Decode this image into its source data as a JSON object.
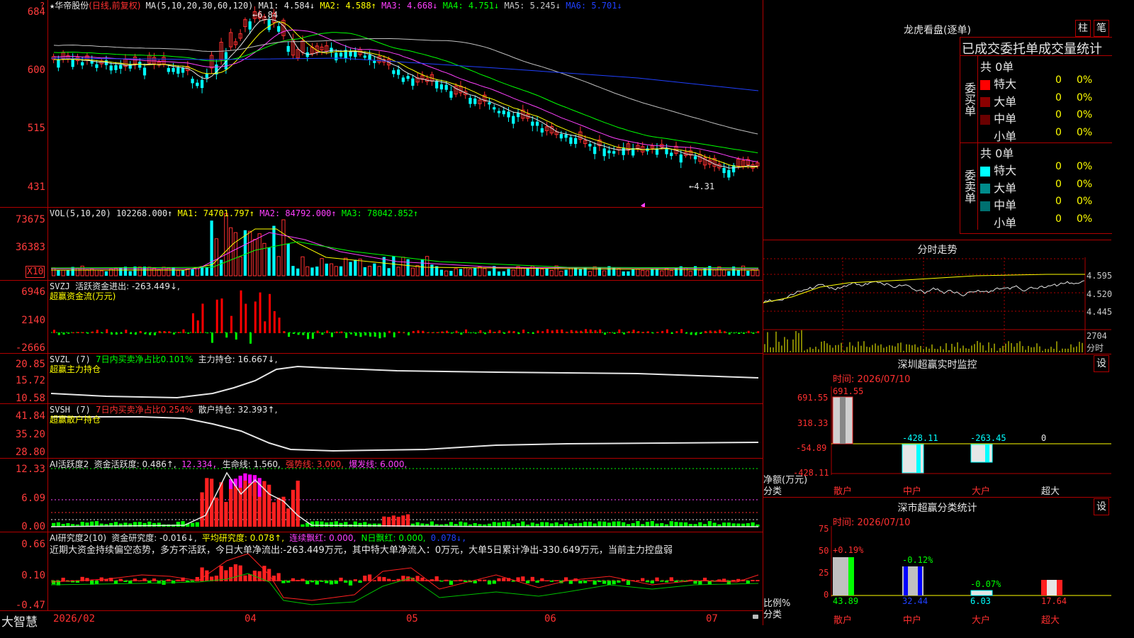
{
  "stock": {
    "name": "华帝股份",
    "period": "(日线,前复权)",
    "star": "★"
  },
  "main": {
    "yticks": [
      "684",
      "600",
      "515",
      "431"
    ],
    "ma_title": "MA(5,10,20,30,60,120)",
    "ma1": "MA1: 4.584↓",
    "ma2": "MA2: 4.588↑",
    "ma3": "MA3: 4.668↓",
    "ma4": "MA4: 4.751↓",
    "ma5": "MA5: 5.245↓",
    "ma6": "MA6: 5.701↓",
    "high_label": "6.84",
    "low_label": "4.31",
    "colors": {
      "ma1": "#e6e6e6",
      "ma2": "#ffff00",
      "ma3": "#ff40ff",
      "ma4": "#00ff00",
      "ma5": "#c0c0c0",
      "ma6": "#2040ff",
      "up": "#ff3030",
      "down": "#00ffff"
    }
  },
  "vol": {
    "yticks": [
      "73675",
      "36383"
    ],
    "unit": "X10",
    "title": "VOL(5,10,20)",
    "value": "102268.000↑",
    "ma1": "MA1: 74701.797↑",
    "ma2": "MA2: 84792.000↑",
    "ma3": "MA3: 78042.852↑"
  },
  "svzj": {
    "yticks": [
      "6946",
      "2140",
      "-2666"
    ],
    "title": "SVZJ",
    "label": "活跃资金进出: -263.449↓,",
    "sub": "超赢资金流(万元)"
  },
  "svzl": {
    "yticks": [
      "20.85",
      "15.72",
      "10.58"
    ],
    "title": "SVZL (7)",
    "seg1": "7日内买卖净占比0.101%",
    "seg2": "主力持仓: 16.667↓,",
    "sub": "超赢主力持仓"
  },
  "svsh": {
    "yticks": [
      "41.84",
      "35.20",
      "28.80"
    ],
    "title": "SVSH (7)",
    "seg1": "7日内买卖净占比0.254%",
    "seg2": "散户持仓: 32.393↑,",
    "sub": "超赢散户持仓"
  },
  "ai1": {
    "yticks": [
      "12.33",
      "6.09",
      "0.00"
    ],
    "title": "AI活跃度2",
    "seg1": "资金活跃度: 0.486↑,",
    "seg2": "12.334,",
    "seg3": "生命线: 1.560,",
    "seg4": "强势线: 3.000,",
    "seg5": "爆发线: 6.000,"
  },
  "ai2": {
    "yticks": [
      "0.66",
      "0.10",
      "-0.47"
    ],
    "title": "AI研究度2(10)",
    "seg1": "资金研究度: -0.016↓,",
    "seg2": "平均研究度: 0.078↑,",
    "seg3": "连续飘红: 0.000,",
    "seg4": "N日飘红: 0.000,",
    "seg5": "0.078↓,",
    "comment": "近期大资金持续偏空态势，多方不活跃，今日大单净流出:-263.449万元，其中特大单净流入：0万元，大单5日累计净出-330.649万元，当前主力控盘弱"
  },
  "footer": {
    "brand": "大智慧",
    "dates": [
      "2026/02",
      "04",
      "05",
      "06",
      "07"
    ]
  },
  "longhu": {
    "title": "龙虎看盘(逐单)",
    "btn1": "柱",
    "btn2": "笔",
    "header": "已成交委托单成交量统计",
    "buy_label": "委买单",
    "sell_label": "委卖单",
    "buy_total": "共 0单",
    "sell_total": "共 0单",
    "buy_rows": [
      {
        "name": "特大",
        "v": "0",
        "p": "0%",
        "c": "#ff0000"
      },
      {
        "name": "大单",
        "v": "0",
        "p": "0%",
        "c": "#8b0000"
      },
      {
        "name": "中单",
        "v": "0",
        "p": "0%",
        "c": "#6a0000"
      },
      {
        "name": "小单",
        "v": "0",
        "p": "0%",
        "c": "#000"
      }
    ],
    "sell_rows": [
      {
        "name": "特大",
        "v": "0",
        "p": "0%",
        "c": "#00ffff"
      },
      {
        "name": "大单",
        "v": "0",
        "p": "0%",
        "c": "#008b8b"
      },
      {
        "name": "中单",
        "v": "0",
        "p": "0%",
        "c": "#007070"
      },
      {
        "name": "小单",
        "v": "0",
        "p": "0%",
        "c": "#000"
      }
    ]
  },
  "fenshi": {
    "title": "分时走势",
    "yticks": [
      "4.595",
      "4.520",
      "4.445"
    ],
    "vol_label": "2704",
    "vol_sub": "分时"
  },
  "sz_monitor": {
    "title": "深圳超赢实时监控",
    "btn": "设",
    "time": "时间: 2026/07/10",
    "yticks": [
      "691.55",
      "318.33",
      "-54.89",
      "-428.11"
    ],
    "cats": [
      "散户",
      "中户",
      "大户",
      "超大"
    ],
    "vals": [
      "691.55",
      "-428.11",
      "-263.45",
      "0"
    ],
    "ylabel1": "净额(万元)",
    "ylabel2": "分类"
  },
  "sz_class": {
    "title": "深市超赢分类统计",
    "btn": "设",
    "time": "时间: 2026/07/10",
    "yticks": [
      "75",
      "50",
      "25",
      "0"
    ],
    "cats": [
      "散户",
      "中户",
      "大户",
      "超大"
    ],
    "vals": [
      "43.89",
      "32.44",
      "6.03",
      "17.64"
    ],
    "pct": [
      "+0.19%",
      "-0.12%",
      "-0.07%",
      ""
    ],
    "ylabel1": "比例%",
    "ylabel2": "分类"
  }
}
